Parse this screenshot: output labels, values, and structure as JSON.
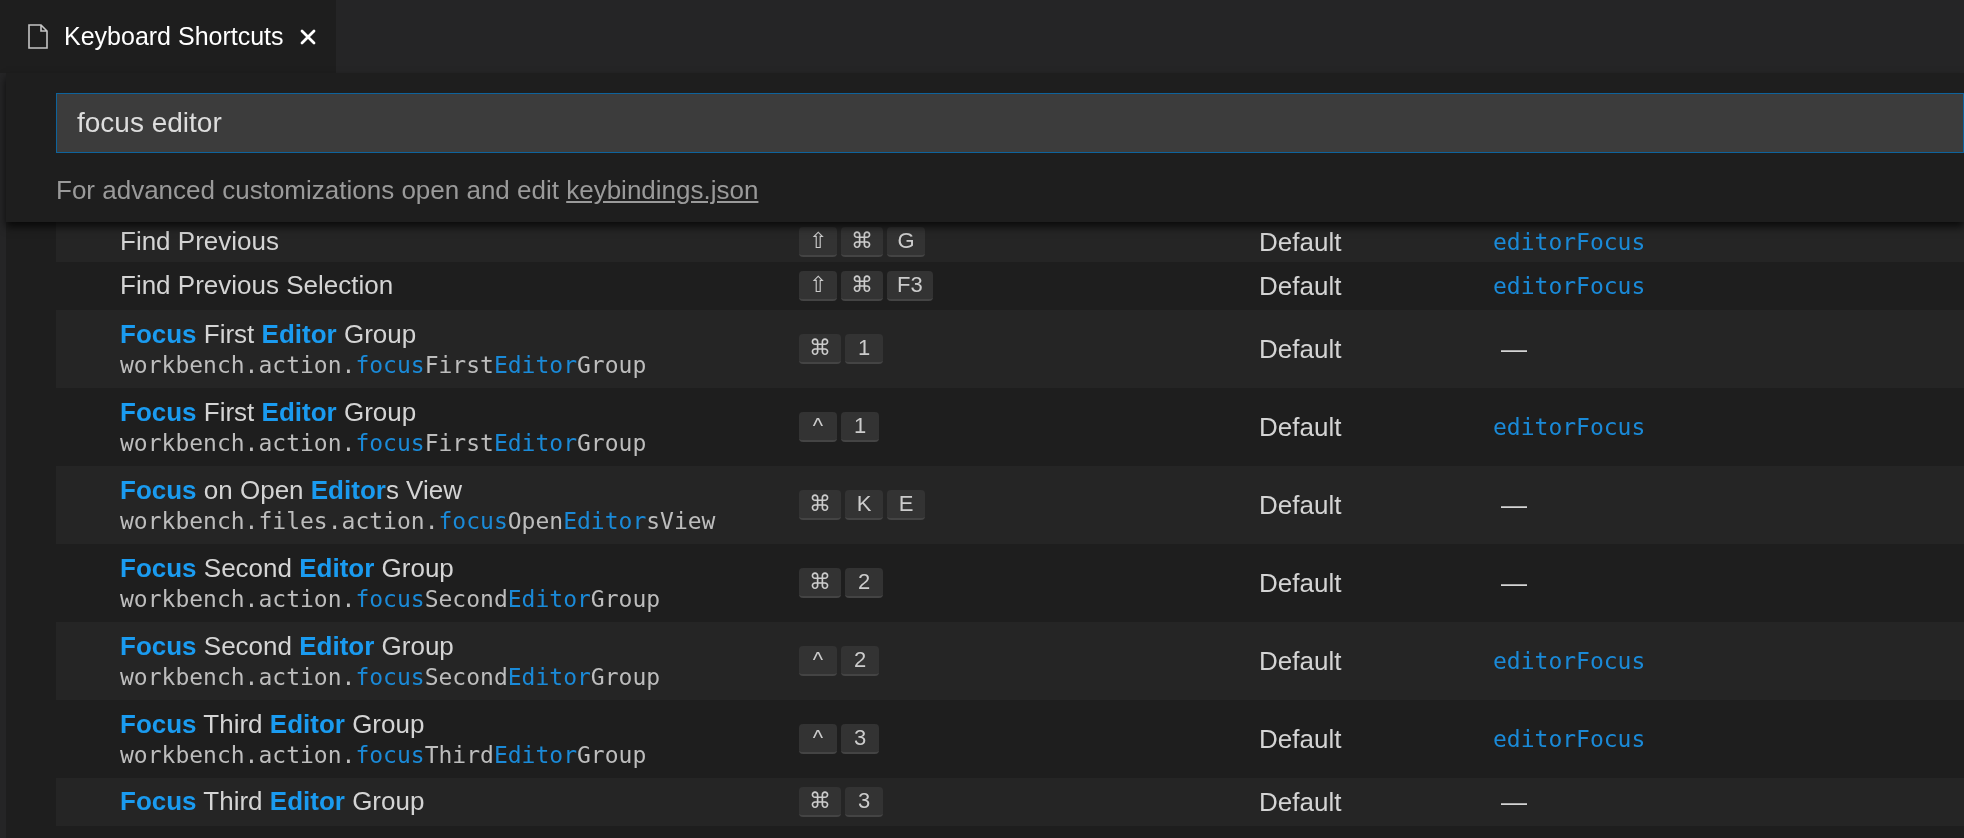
{
  "tabs": [
    {
      "label": "Keyboard Shortcuts",
      "selected": true
    }
  ],
  "search": {
    "value": "focus editor"
  },
  "help": {
    "text": "For advanced customizations open and edit",
    "link": "keybindings.json"
  },
  "rows": [
    {
      "title": "Find Previous",
      "keys": [
        "⇧",
        "⌘",
        "G"
      ],
      "source": "Default",
      "when": {
        "text": "editorFocus",
        "kind": "context"
      }
    },
    {
      "title": "Find Previous Selection",
      "keys": [
        "⇧",
        "⌘",
        "F3"
      ],
      "source": "Default",
      "when": {
        "text": "editorFocus",
        "kind": "context"
      }
    },
    {
      "title": "**Focus** First **Editor** Group",
      "command": [
        {
          "text": "workbench.action.",
          "match": false
        },
        {
          "text": "focus",
          "match": true
        },
        {
          "text": "First",
          "match": false
        },
        {
          "text": "Editor",
          "match": true
        },
        {
          "text": "Group",
          "match": false
        }
      ],
      "keys": [
        "⌘",
        "1"
      ],
      "source": "Default",
      "when": {
        "text": "—",
        "kind": "none"
      }
    },
    {
      "title": "**Focus** First **Editor** Group",
      "command": [
        {
          "text": "workbench.action.",
          "match": false
        },
        {
          "text": "focus",
          "match": true
        },
        {
          "text": "First",
          "match": false
        },
        {
          "text": "Editor",
          "match": true
        },
        {
          "text": "Group",
          "match": false
        }
      ],
      "keys": [
        "^",
        "1"
      ],
      "source": "Default",
      "when": {
        "text": "editorFocus",
        "kind": "context"
      }
    },
    {
      "title": "**Focus** on Open **Editor**s View",
      "command": [
        {
          "text": "workbench.files.action.",
          "match": false
        },
        {
          "text": "focus",
          "match": true
        },
        {
          "text": "Open",
          "match": false
        },
        {
          "text": "Editor",
          "match": true
        },
        {
          "text": "sView",
          "match": false
        }
      ],
      "keys": [
        "⌘",
        "K",
        "E"
      ],
      "source": "Default",
      "when": {
        "text": "—",
        "kind": "none"
      }
    },
    {
      "title": "**Focus** Second **Editor** Group",
      "command": [
        {
          "text": "workbench.action.",
          "match": false
        },
        {
          "text": "focus",
          "match": true
        },
        {
          "text": "Second",
          "match": false
        },
        {
          "text": "Editor",
          "match": true
        },
        {
          "text": "Group",
          "match": false
        }
      ],
      "keys": [
        "⌘",
        "2"
      ],
      "source": "Default",
      "when": {
        "text": "—",
        "kind": "none"
      }
    },
    {
      "title": "**Focus** Second **Editor** Group",
      "command": [
        {
          "text": "workbench.action.",
          "match": false
        },
        {
          "text": "focus",
          "match": true
        },
        {
          "text": "Second",
          "match": false
        },
        {
          "text": "Editor",
          "match": true
        },
        {
          "text": "Group",
          "match": false
        }
      ],
      "keys": [
        "^",
        "2"
      ],
      "source": "Default",
      "when": {
        "text": "editorFocus",
        "kind": "context"
      }
    },
    {
      "title": "**Focus** Third **Editor** Group",
      "command": [
        {
          "text": "workbench.action.",
          "match": false
        },
        {
          "text": "focus",
          "match": true
        },
        {
          "text": "Third",
          "match": false
        },
        {
          "text": "Editor",
          "match": true
        },
        {
          "text": "Group",
          "match": false
        }
      ],
      "keys": [
        "^",
        "3"
      ],
      "source": "Default",
      "when": {
        "text": "editorFocus",
        "kind": "context"
      }
    },
    {
      "title": "**Focus** Third **Editor** Group",
      "keys": [
        "⌘",
        "3"
      ],
      "source": "Default",
      "when": {
        "text": "—",
        "kind": "none"
      }
    }
  ]
}
